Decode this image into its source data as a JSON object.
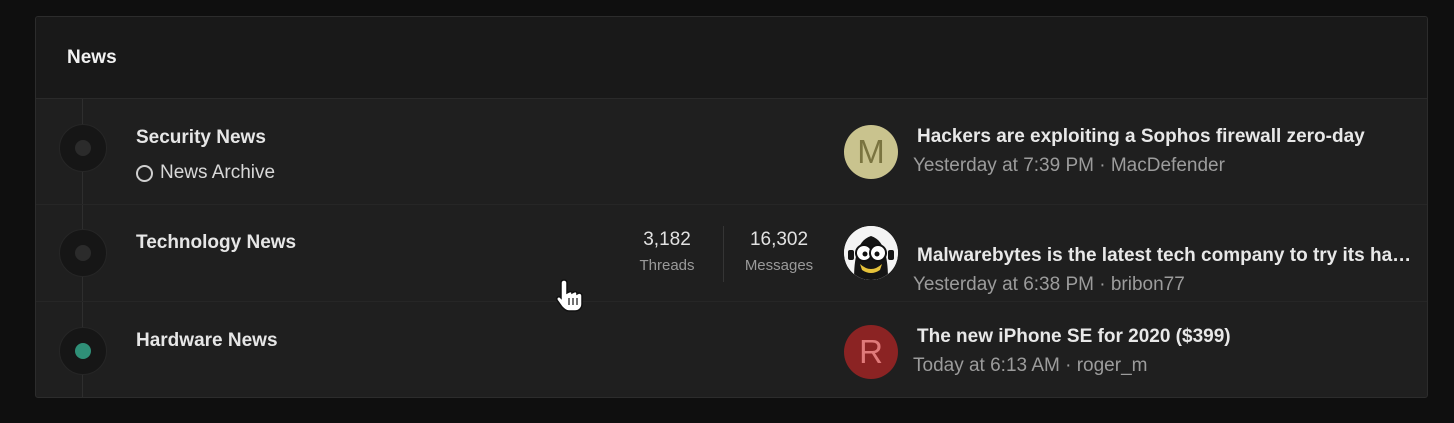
{
  "category": {
    "title": "News"
  },
  "forums": [
    {
      "title": "Security News",
      "subforum": "News Archive",
      "threads": "",
      "threads_label": "",
      "messages": "",
      "messages_label": "",
      "status": "read",
      "latest": {
        "title": "Hackers are exploiting a Sophos firewall zero-day",
        "time": "Yesterday at 7:39 PM",
        "separator": "·",
        "user": "MacDefender",
        "avatar_letter": "M",
        "avatar_bg": "#c9c38e",
        "avatar_fg": "#7a7440"
      }
    },
    {
      "title": "Technology News",
      "threads": "3,182",
      "threads_label": "Threads",
      "messages": "16,302",
      "messages_label": "Messages",
      "status": "read",
      "latest": {
        "title": "Malwarebytes is the latest tech company to try its hand at ...",
        "time": "Yesterday at 6:38 PM",
        "separator": "·",
        "user": "bribon77",
        "avatar_icon": "cartoon-character-avatar"
      }
    },
    {
      "title": "Hardware News",
      "status": "unread",
      "latest": {
        "title": "The new iPhone SE for 2020 ($399)",
        "time": "Today at 6:13 AM",
        "separator": "·",
        "user": "roger_m",
        "avatar_letter": "R",
        "avatar_bg": "#8b2323",
        "avatar_fg": "#e07a7a"
      }
    }
  ],
  "colors": {
    "background": "#0f0f0f",
    "panel": "#1f1f1f",
    "unread_accent": "#2f8f77"
  }
}
